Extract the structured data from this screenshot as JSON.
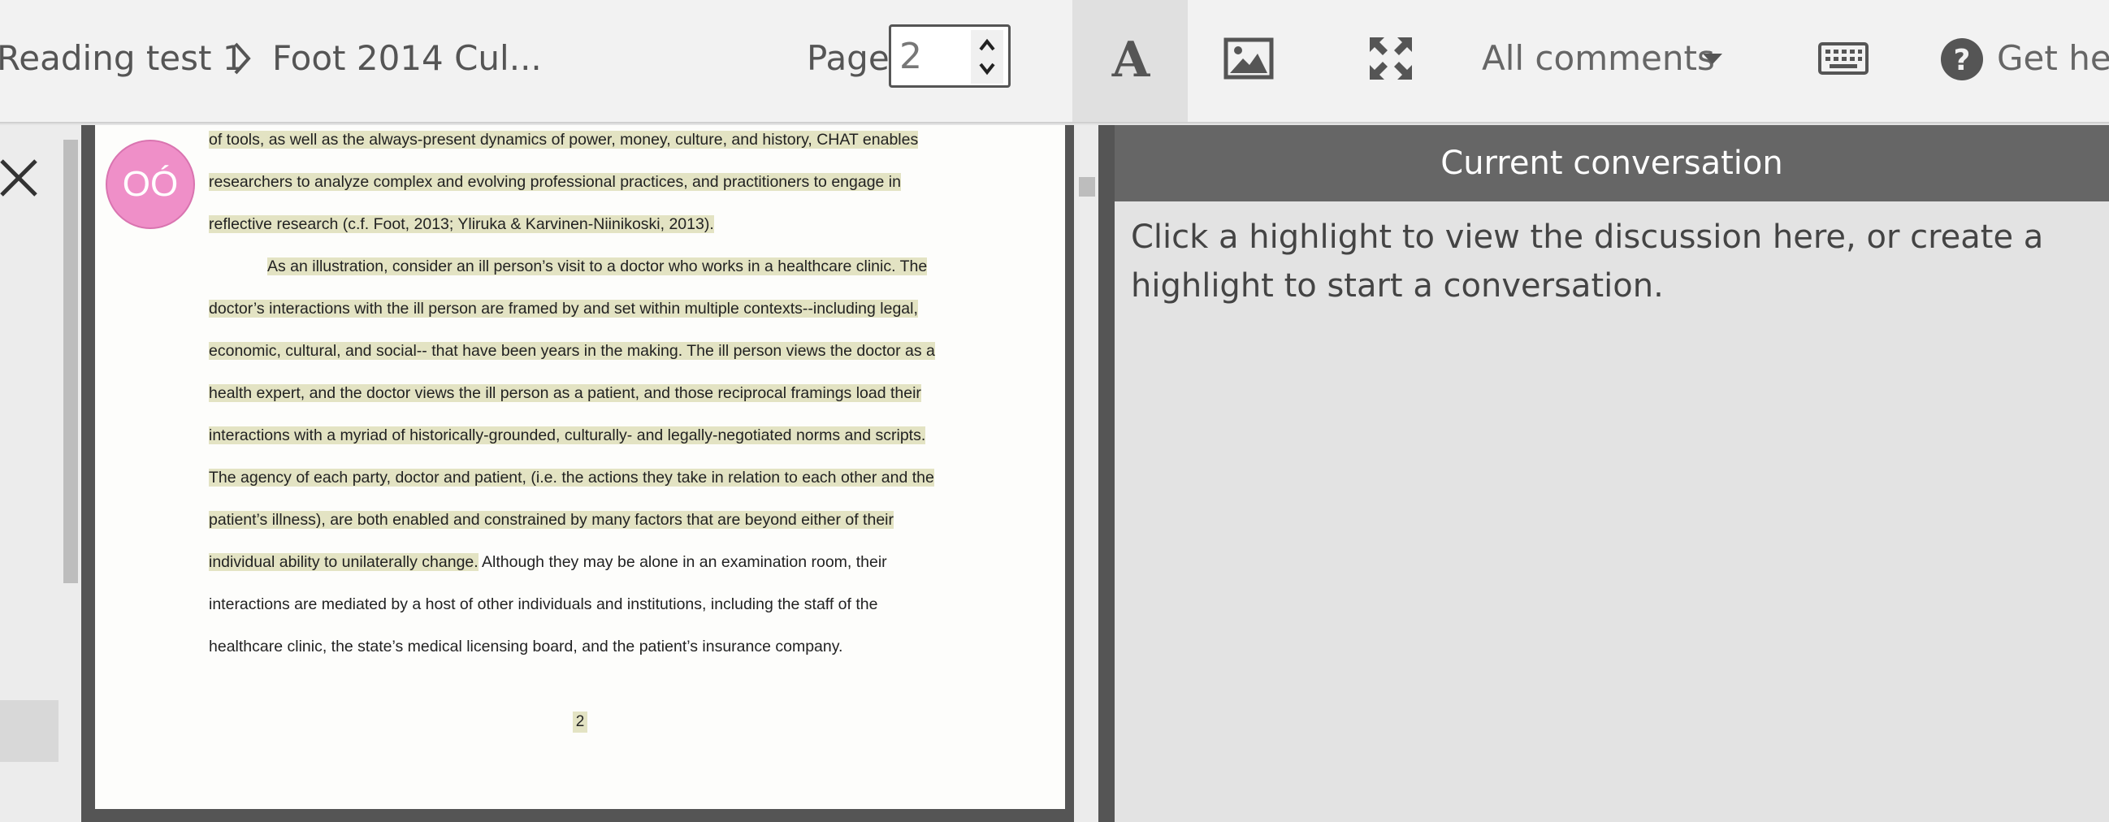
{
  "toolbar": {
    "breadcrumb": [
      "Reading test 1",
      "Foot 2014 Cul..."
    ],
    "page_label": "Page",
    "page_value": "2",
    "comments_filter": "All comments",
    "help_label": "Get help",
    "icons": [
      "text-view-icon",
      "image-view-icon",
      "fullscreen-icon",
      "caret-down-icon",
      "keyboard-icon",
      "help-icon"
    ]
  },
  "document": {
    "avatar_initials": "OÓ",
    "lines": [
      "of tools, as well as the always-present dynamics of power, money, culture, and history, CHAT  enables",
      "researchers to analyze complex and evolving professional practices, and practitioners to engage in",
      "reflective research (c.f. Foot, 2013; Yliruka & Karvinen-Niinikoski, 2013).",
      "As an illustration, consider an ill person’s visit to a doctor who works in a healthcare clinic. The",
      "doctor’s interactions with the ill person are framed by and set within multiple contexts--including legal,",
      "economic, cultural, and social-- that have been years in the making.  The ill person views the doctor as a",
      "health expert, and the doctor views the ill person as a patient, and those reciprocal framings load their",
      "interactions with a myriad of historically-grounded, culturally- and legally-negotiated norms and scripts.",
      "The agency of each party, doctor and patient, (i.e. the actions they take in relation to each other and the",
      "patient’s illness), are both enabled and constrained by many factors that are beyond either of their",
      "individual ability to unilaterally change.",
      " Although they may be alone in an examination room, their",
      "interactions are mediated by a host of other individuals and institutions, including the staff of the",
      "healthcare clinic, the state’s medical licensing board, and the patient’s insurance company."
    ],
    "page_number": "2"
  },
  "conversation": {
    "title": "Current conversation",
    "message": "Click a highlight to view the discussion here, or create a highlight to start a conversation."
  },
  "colors": {
    "highlight": "#e3e3c3",
    "avatar": "#ef8fc8",
    "conv_header": "#666666"
  }
}
